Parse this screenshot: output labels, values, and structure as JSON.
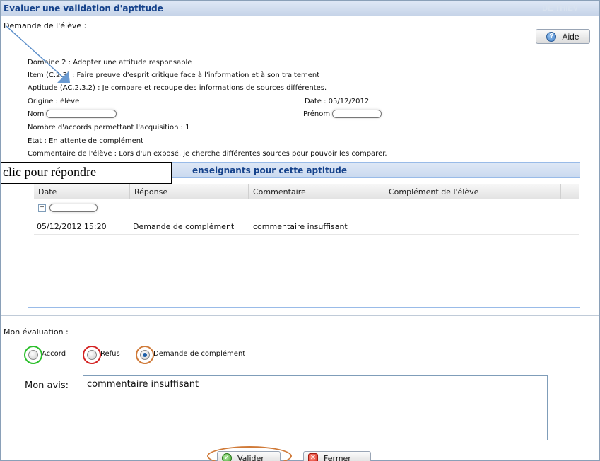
{
  "window": {
    "title": "Evaluer une validation d'aptitude",
    "ghost_text": "DE THIEV"
  },
  "request": {
    "heading": "Demande de l'élève :",
    "help_label": "Aide",
    "domaine": "Domaine 2 : Adopter une attitude responsable",
    "item": "Item (C.2.3) : Faire preuve d'esprit critique face à l'information et à son traitement",
    "aptitude": "Aptitude (AC.2.3.2) : Je compare et recoupe des informations de sources différentes.",
    "origine": "Origine : élève",
    "date": "Date : 05/12/2012",
    "nom_label": "Nom :",
    "prenom_label": "Prénom :",
    "accords": "Nombre d'accords permettant l'acquisition : 1",
    "etat": "Etat : En attente de complément",
    "commentaire": "Commentaire de l'élève : Lors d'un exposé, je cherche différentes sources pour pouvoir les comparer."
  },
  "grid": {
    "title_visible": "enseignants pour cette aptitude",
    "columns": [
      "Date",
      "Réponse",
      "Commentaire",
      "Complément de l'élève"
    ],
    "rows": [
      {
        "date": "05/12/2012 15:20",
        "reponse": "Demande de complément",
        "commentaire": "commentaire insuffisant",
        "complement": ""
      }
    ]
  },
  "callout": {
    "text": "clic pour répondre"
  },
  "evaluation": {
    "heading": "Mon évaluation :",
    "options": [
      {
        "label": "Accord",
        "ring_color": "#2bbf2b",
        "checked": false
      },
      {
        "label": "Refus",
        "ring_color": "#d42222",
        "checked": false
      },
      {
        "label": "Demande de complément",
        "ring_color": "#d07a38",
        "checked": true
      }
    ],
    "avis_label": "Mon avis:",
    "avis_value": "commentaire insuffisant"
  },
  "buttons": {
    "valider": "Valider",
    "fermer": "Fermer"
  }
}
